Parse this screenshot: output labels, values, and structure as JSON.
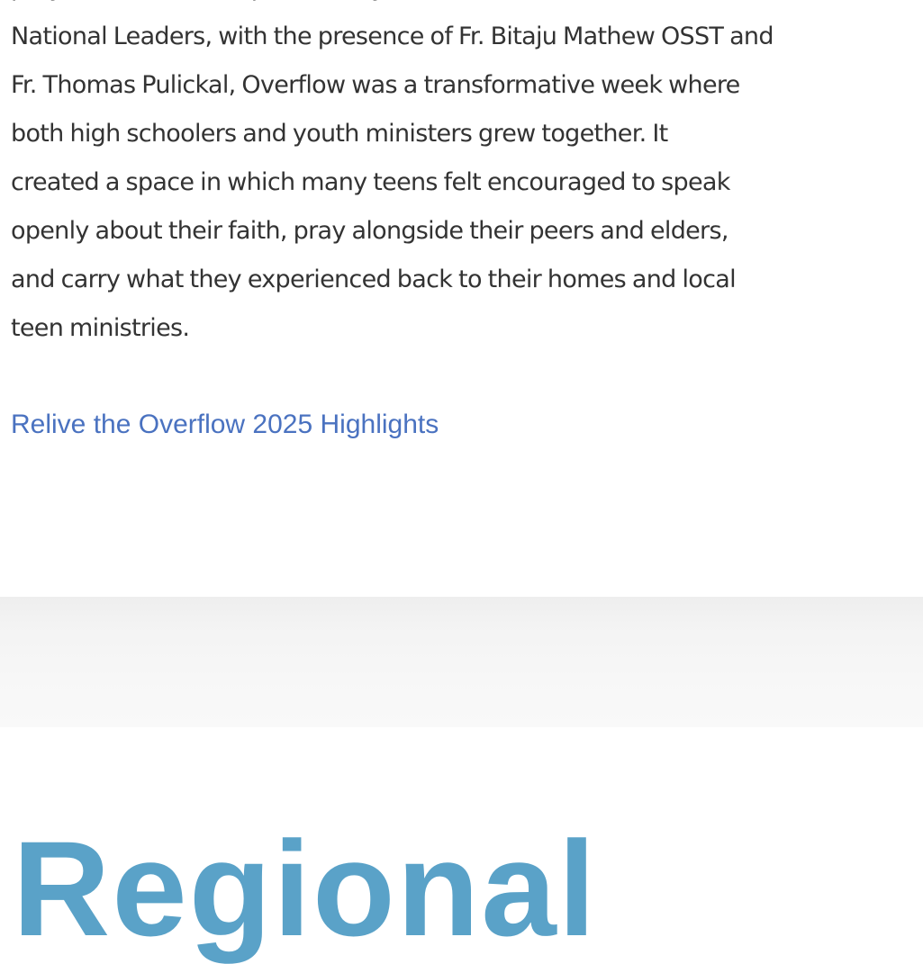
{
  "article": {
    "lines": [
      "prayer, and fellowship with the youth ministers and",
      "National Leaders, with the presence of Fr. Bitaju Mathew OSST and",
      "Fr. Thomas Pulickal, Overflow was a transformative week where",
      "both high schoolers and youth ministers grew together. It",
      "created a space in which many teens felt encouraged to speak",
      "openly about their faith, pray alongside their peers and elders,",
      "and carry what they experienced back to their homes and local",
      "teen ministries."
    ]
  },
  "highlights_link": {
    "label": "Relive the Overflow 2025 Highlights"
  },
  "next_section": {
    "heading": "Regional"
  }
}
